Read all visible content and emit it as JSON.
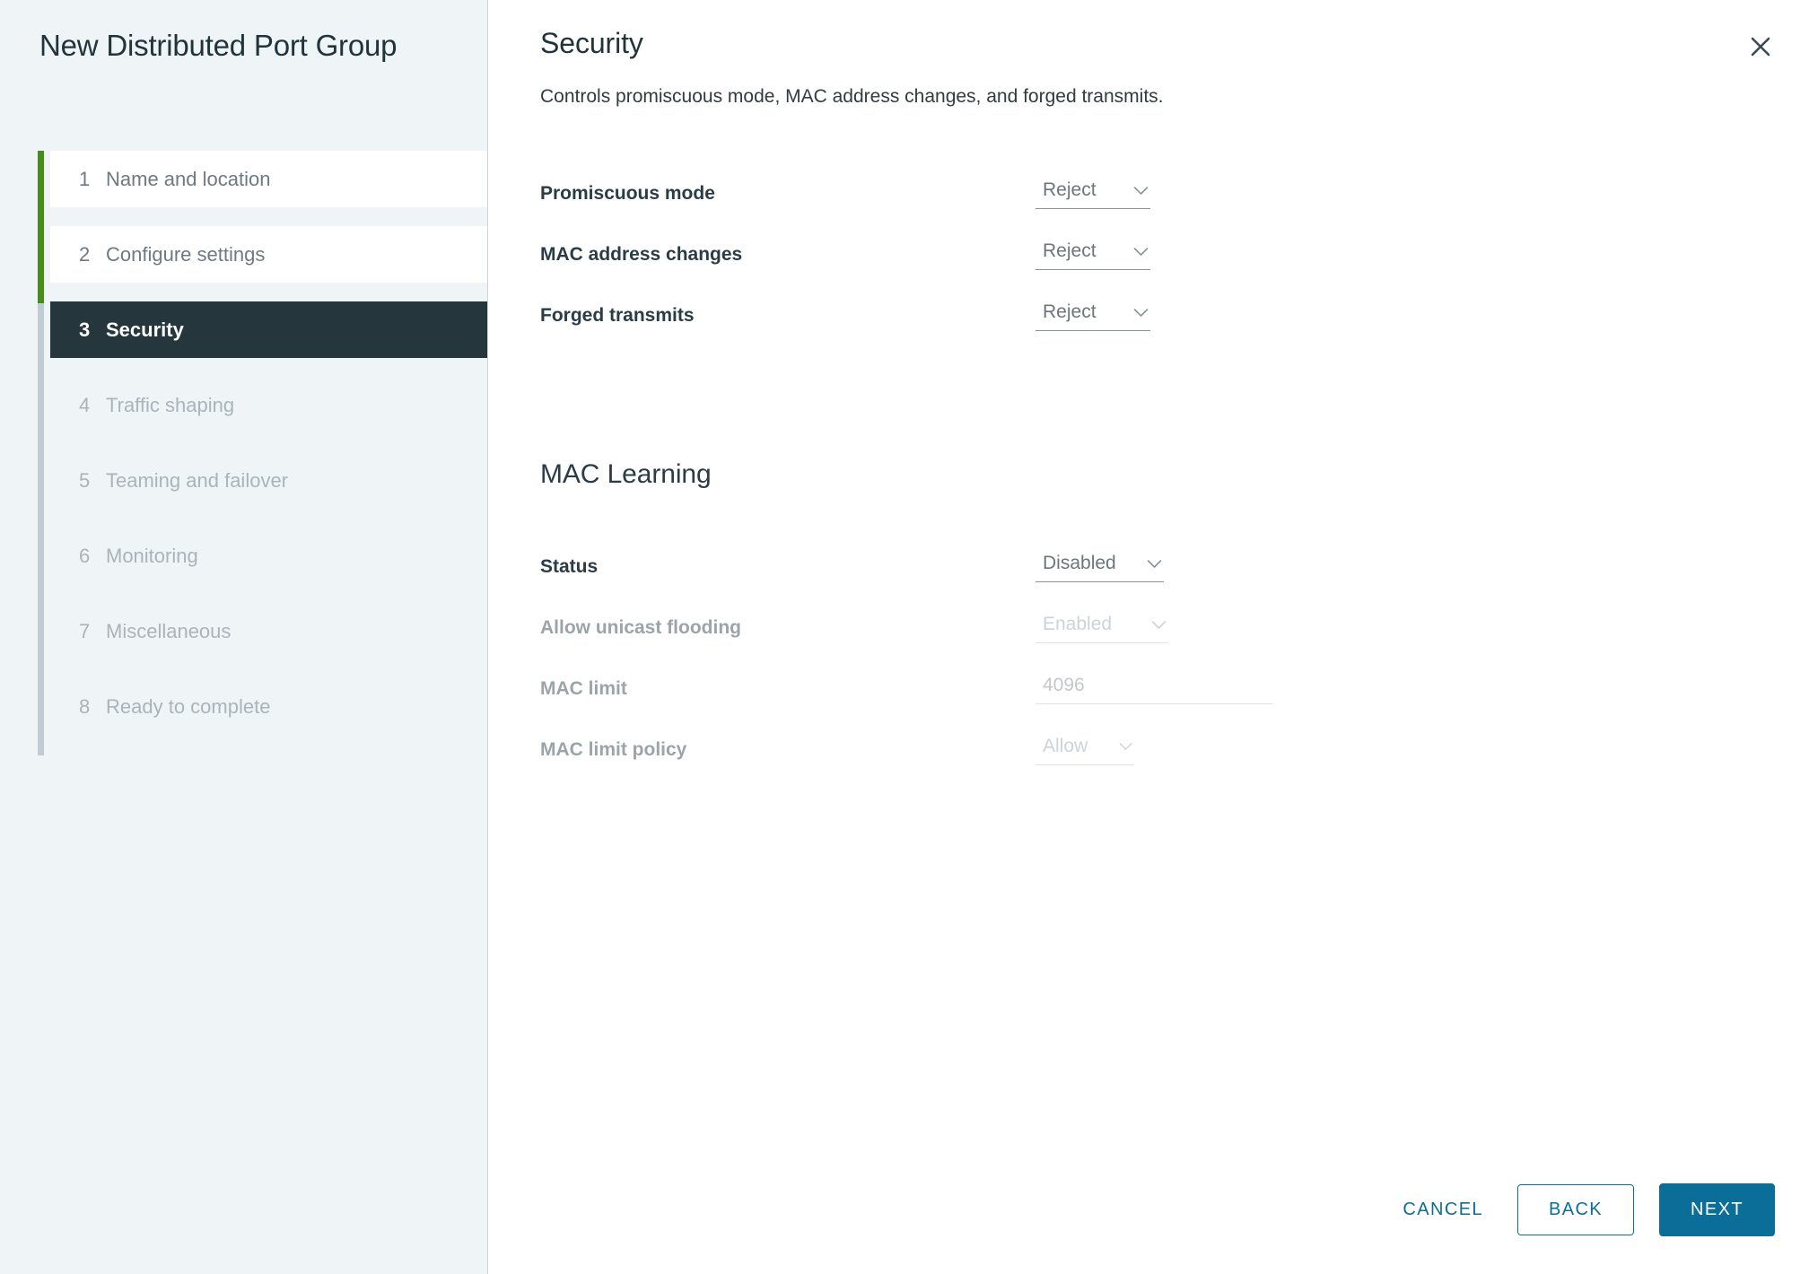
{
  "wizard": {
    "title": "New Distributed Port Group",
    "steps": [
      {
        "num": "1",
        "label": "Name and location",
        "state": "visited"
      },
      {
        "num": "2",
        "label": "Configure settings",
        "state": "visited"
      },
      {
        "num": "3",
        "label": "Security",
        "state": "active"
      },
      {
        "num": "4",
        "label": "Traffic shaping",
        "state": "pending"
      },
      {
        "num": "5",
        "label": "Teaming and failover",
        "state": "pending"
      },
      {
        "num": "6",
        "label": "Monitoring",
        "state": "pending"
      },
      {
        "num": "7",
        "label": "Miscellaneous",
        "state": "pending"
      },
      {
        "num": "8",
        "label": "Ready to complete",
        "state": "pending"
      }
    ]
  },
  "page": {
    "title": "Security",
    "description": "Controls promiscuous mode, MAC address changes, and forged transmits.",
    "close_icon": "close-icon"
  },
  "security": {
    "promiscuous_mode": {
      "label": "Promiscuous mode",
      "value": "Reject"
    },
    "mac_address_changes": {
      "label": "MAC address changes",
      "value": "Reject"
    },
    "forged_transmits": {
      "label": "Forged transmits",
      "value": "Reject"
    }
  },
  "mac_learning": {
    "heading": "MAC Learning",
    "status": {
      "label": "Status",
      "value": "Disabled"
    },
    "allow_unicast_flooding": {
      "label": "Allow unicast flooding",
      "value": "Enabled"
    },
    "mac_limit": {
      "label": "MAC limit",
      "value": "",
      "placeholder": "4096"
    },
    "mac_limit_policy": {
      "label": "MAC limit policy",
      "value": "Allow"
    }
  },
  "footer": {
    "cancel": "CANCEL",
    "back": "BACK",
    "next": "NEXT"
  },
  "colors": {
    "accent": "#0b6e99",
    "sidebar_bg": "#eff4f7",
    "active_step_bg": "#26363d",
    "progress_done": "#488c1a",
    "progress_rail": "#c0ccd3"
  }
}
